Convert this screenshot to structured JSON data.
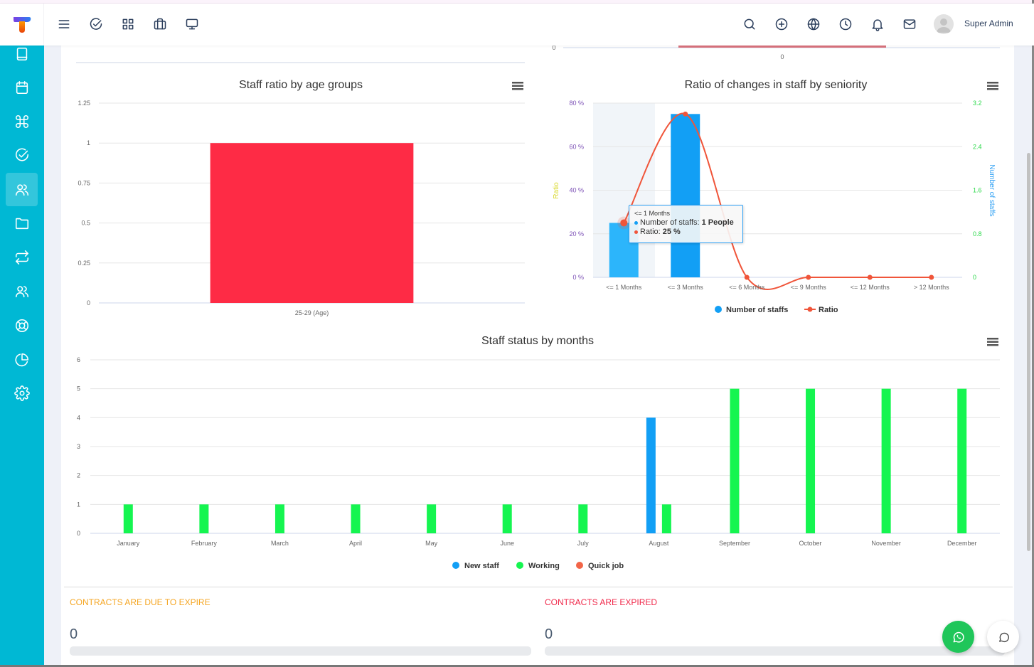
{
  "header": {
    "user_name": "Super Admin",
    "left_icons": [
      "menu-icon",
      "check-circle-icon",
      "grid-icon",
      "briefcase-icon",
      "monitor-icon"
    ],
    "right_icons": [
      "search-icon",
      "plus-circle-icon",
      "globe-icon",
      "clock-icon",
      "bell-icon",
      "mail-icon"
    ]
  },
  "sidebar": {
    "items": [
      {
        "icon": "book-icon"
      },
      {
        "icon": "calendar-icon"
      },
      {
        "icon": "command-icon"
      },
      {
        "icon": "check-circle-icon"
      },
      {
        "icon": "users-icon",
        "active": true
      },
      {
        "icon": "folder-icon"
      },
      {
        "icon": "repeat-icon"
      },
      {
        "icon": "users-icon"
      },
      {
        "icon": "life-buoy-icon"
      },
      {
        "icon": "pie-chart-icon"
      },
      {
        "icon": "settings-icon"
      }
    ]
  },
  "colors": {
    "sidebar": "#00b8d4",
    "age_bar": "#fe2b45",
    "staff_bar": "#129ff5",
    "staff_bar_hover": "#2cb5fb",
    "ratio_line": "#f0553a",
    "new_staff": "#129ff5",
    "working": "#15f550",
    "quick_job": "#f26548",
    "due_label": "#f5a623",
    "expired_label": "#f0284a"
  },
  "partial_top_chart": {
    "y_tick": "0",
    "x_tick": "0"
  },
  "chart_data": [
    {
      "id": "age",
      "type": "bar",
      "title": "Staff ratio by age groups",
      "categories": [
        "25-29 (Age)"
      ],
      "values": [
        1
      ],
      "ylim": [
        0,
        1.25
      ],
      "y_ticks": [
        "0",
        "0.25",
        "0.5",
        "0.75",
        "1",
        "1.25"
      ],
      "grid": true,
      "legend": "none"
    },
    {
      "id": "seniority",
      "type": "bar",
      "title": "Ratio of changes in staff by seniority",
      "categories": [
        "<= 1 Months",
        "<= 3 Months",
        "<= 6 Months",
        "<= 9 Months",
        "<= 12 Months",
        "> 12 Months"
      ],
      "series": [
        {
          "name": "Number of staffs",
          "type": "bar",
          "axis": "right",
          "values": [
            1,
            3,
            0,
            0,
            0,
            0
          ]
        },
        {
          "name": "Ratio",
          "type": "spline",
          "axis": "left",
          "values": [
            25,
            75,
            0,
            0,
            0,
            0
          ]
        }
      ],
      "ylabel_left": "Ratio",
      "ylabel_right": "Number of staffs",
      "ylim_left": [
        0,
        80
      ],
      "ylim_right": [
        0,
        3.2
      ],
      "y_ticks_left": [
        "0 %",
        "20 %",
        "40 %",
        "60 %",
        "80 %"
      ],
      "y_ticks_right": [
        "0",
        "0.8",
        "1.6",
        "2.4",
        "3.2"
      ],
      "legend": "bottom",
      "tooltip": {
        "header": "<= 1 Months",
        "staff_label": "Number of staffs: ",
        "staff_value": "1 People",
        "ratio_label": "Ratio: ",
        "ratio_value": "25 %"
      }
    },
    {
      "id": "status",
      "type": "bar",
      "title": "Staff status by months",
      "categories": [
        "January",
        "February",
        "March",
        "April",
        "May",
        "June",
        "July",
        "August",
        "September",
        "October",
        "November",
        "December"
      ],
      "series": [
        {
          "name": "New staff",
          "values": [
            0,
            0,
            0,
            0,
            0,
            0,
            0,
            4,
            0,
            0,
            0,
            0
          ]
        },
        {
          "name": "Working",
          "values": [
            1,
            1,
            1,
            1,
            1,
            1,
            1,
            1,
            5,
            5,
            5,
            5
          ]
        },
        {
          "name": "Quick job",
          "values": [
            0,
            0,
            0,
            0,
            0,
            0,
            0,
            0,
            0,
            0,
            0,
            0
          ]
        }
      ],
      "ylim": [
        0,
        6
      ],
      "y_ticks": [
        "0",
        "1",
        "2",
        "3",
        "4",
        "5",
        "6"
      ],
      "legend": "bottom"
    }
  ],
  "contracts": {
    "due": {
      "label": "CONTRACTS ARE DUE TO EXPIRE",
      "value": "0",
      "progress": 0
    },
    "expired": {
      "label": "CONTRACTS ARE EXPIRED",
      "value": "0",
      "progress": 0
    }
  }
}
